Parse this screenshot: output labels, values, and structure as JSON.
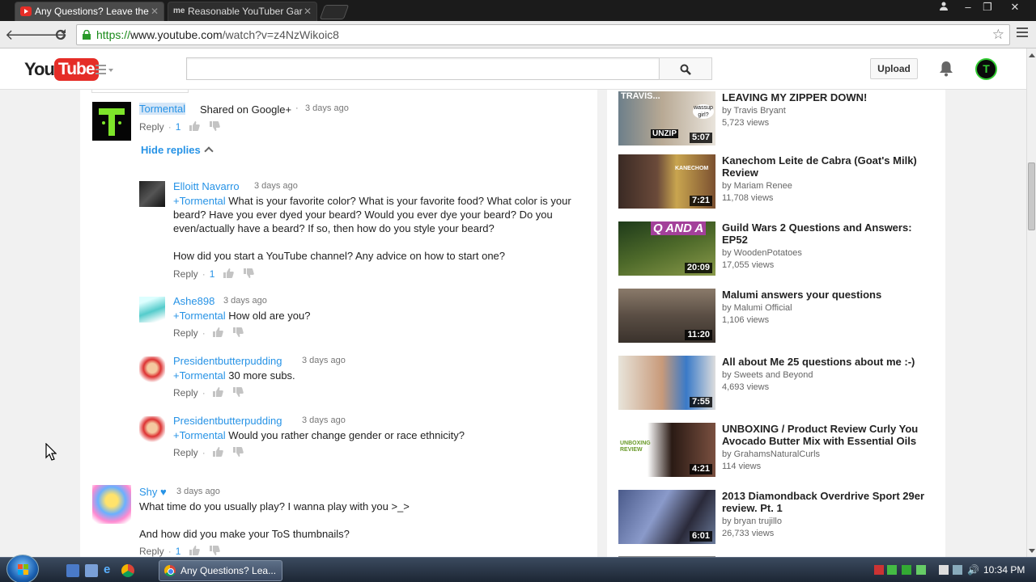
{
  "browser": {
    "tabs": [
      {
        "title": "Any Questions? Leave the",
        "active": true
      },
      {
        "title": "Reasonable YouTuber Gar",
        "active": false
      }
    ],
    "url_scheme": "https://",
    "url_host": "www.youtube.com",
    "url_path": "/watch?v=z4NzWikoic8"
  },
  "header": {
    "logo_you": "You",
    "logo_tube": "Tube",
    "search_placeholder": "",
    "upload_label": "Upload",
    "avatar_letter": "T"
  },
  "parent_comment": {
    "author": "Tormental",
    "text": "Shared on Google+",
    "age": "3 days ago",
    "reply_label": "Reply",
    "likes": "1"
  },
  "hide_replies_label": "Hide replies",
  "replies": [
    {
      "author": "Elloitt Navarro",
      "age": "3 days ago",
      "mention": "+Tormental",
      "text": " What is your favorite color? What is your favorite food? What color is your beard? Have you ever dyed your beard? Would you ever dye your beard? Do you even/actually have a beard? If so, then how do you style your beard?",
      "text2": "How did you start a YouTube channel? Any advice on how to start one?",
      "reply_label": "Reply",
      "likes": "1"
    },
    {
      "author": "Ashe898",
      "age": "3 days ago",
      "mention": "+Tormental",
      "text": " How old are you?",
      "reply_label": "Reply"
    },
    {
      "author": "Presidentbutterpudding",
      "age": "3 days ago",
      "mention": "+Tormental",
      "text": " 30 more subs.",
      "reply_label": "Reply"
    },
    {
      "author": "Presidentbutterpudding",
      "age": "3 days ago",
      "mention": "+Tormental",
      "text": " Would you rather change gender or race ethnicity?",
      "reply_label": "Reply"
    }
  ],
  "next_comment": {
    "author": "Shy ♥",
    "age": "3 days ago",
    "text": "What time do you usually play? I wanna play with you >_>",
    "text2": "And how did you make your ToS thumbnails?",
    "reply_label": "Reply",
    "likes": "1"
  },
  "related": [
    {
      "title": "LEAVING MY ZIPPER DOWN!",
      "by": "by Travis Bryant",
      "views": "5,723 views",
      "duration": "5:07",
      "thumb_text": "TRAVIS...",
      "thumb_text2": "UNZIP",
      "bubble": "wassup girl?"
    },
    {
      "title": "Kanechom Leite de Cabra (Goat's Milk) Review",
      "by": "by Mariam Renee",
      "views": "11,708 views",
      "duration": "7:21",
      "thumb_text": "KANECHOM"
    },
    {
      "title": "Guild Wars 2 Questions and Answers: EP52",
      "by": "by WoodenPotatoes",
      "views": "17,055 views",
      "duration": "20:09",
      "thumb_text": "Q AND A"
    },
    {
      "title": "Malumi answers your questions",
      "by": "by Malumi Official",
      "views": "1,106 views",
      "duration": "11:20"
    },
    {
      "title": "All about Me 25 questions about me :-)",
      "by": "by Sweets and Beyond",
      "views": "4,693 views",
      "duration": "7:55"
    },
    {
      "title": "UNBOXING / Product Review Curly You Avocado Butter Mix with Essential Oils",
      "by": "by GrahamsNaturalCurls",
      "views": "114 views",
      "duration": "4:21",
      "thumb_text": "UNBOXING REVIEW"
    },
    {
      "title": "2013 Diamondback Overdrive Sport 29er review. Pt. 1",
      "by": "by bryan trujillo",
      "views": "26,733 views",
      "duration": "6:01"
    }
  ],
  "taskbar": {
    "task_label": "Any Questions? Lea...",
    "clock": "10:34 PM"
  }
}
